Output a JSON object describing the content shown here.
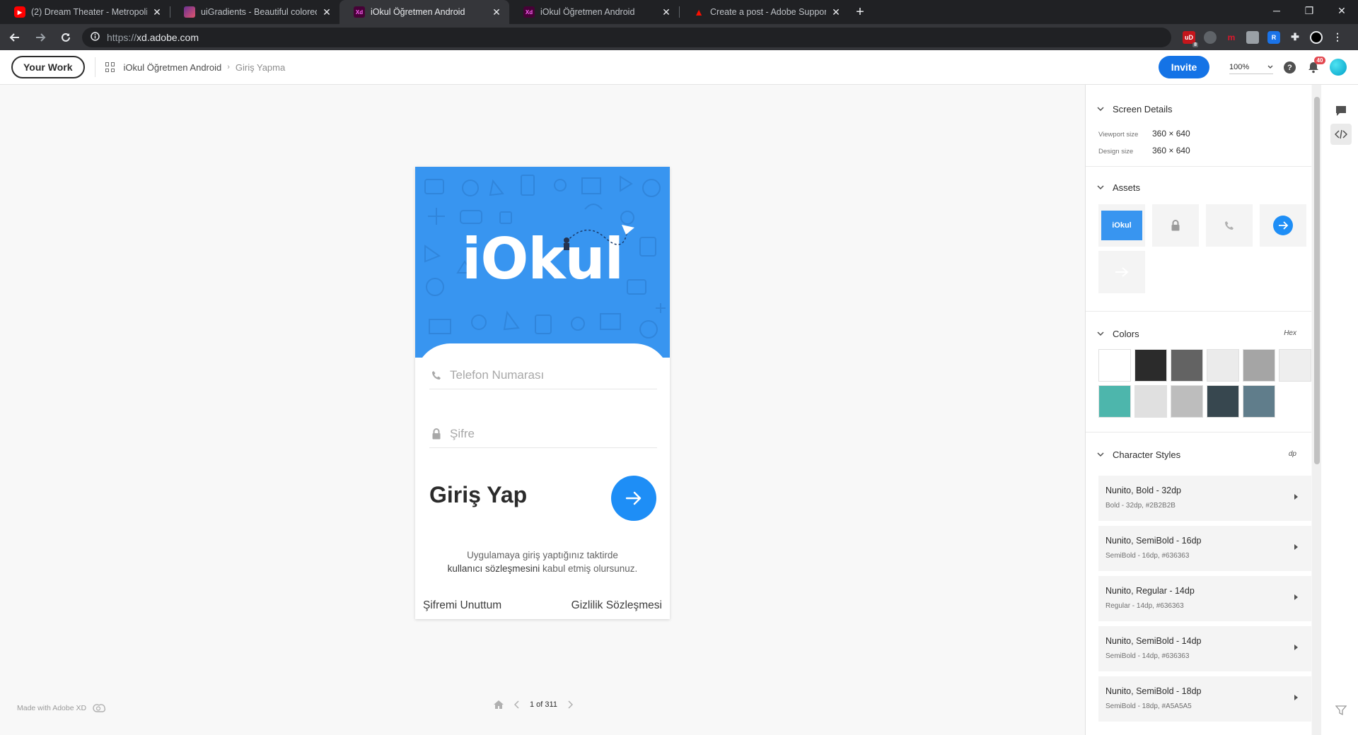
{
  "browser": {
    "tabs": [
      {
        "title": "(2) Dream Theater - Metropolis P",
        "favicon": "youtube-icon"
      },
      {
        "title": "uiGradients - Beautiful colored g",
        "favicon": "uigradients-icon"
      },
      {
        "title": "iOkul Öğretmen Android",
        "favicon": "xd-icon",
        "active": true
      },
      {
        "title": "iOkul Öğretmen Android",
        "favicon": "xd-icon"
      },
      {
        "title": "Create a post - Adobe Support C",
        "favicon": "adobe-icon"
      }
    ],
    "url_scheme": "https://",
    "url_host": "xd.adobe.com",
    "extension_badges": {
      "ud_count": "8"
    }
  },
  "header": {
    "your_work": "Your Work",
    "project": "iOkul Öğretmen Android",
    "screen": "Giriş Yapma",
    "invite": "Invite",
    "zoom": "100%",
    "notification_count": "40"
  },
  "artboard": {
    "logo": "iOkul",
    "phone_placeholder": "Telefon Numarası",
    "password_placeholder": "Şifre",
    "login_title": "Giriş Yap",
    "terms_line1": "Uygulamaya giriş yaptığınız taktirde",
    "terms_link": "kullanıcı sözleşmesini",
    "terms_line2_rest": " kabul etmiş olursunuz.",
    "forgot": "Şifremi Unuttum",
    "privacy": "Gizlilik Sözleşmesi",
    "colors": {
      "hero": "#3895F0",
      "button": "#1E8EF6"
    }
  },
  "footer": {
    "made_with": "Made with Adobe XD",
    "pager": "1 of 311"
  },
  "panel": {
    "screen_details": {
      "title": "Screen Details",
      "viewport_label": "Viewport size",
      "viewport_value": "360 × 640",
      "design_label": "Design size",
      "design_value": "360 × 640"
    },
    "assets": {
      "title": "Assets",
      "logo_label": "iOkul"
    },
    "colors": {
      "title": "Colors",
      "format": "Hex",
      "swatches": [
        "#FFFFFF",
        "#2B2B2B",
        "#636363",
        "#EBEBEB",
        "#A5A5A5",
        "#EEEEEE",
        "#4DB6AC",
        "#E0E0E0",
        "#BDBDBD",
        "#37474F",
        "#607D8B"
      ]
    },
    "character_styles": {
      "title": "Character Styles",
      "unit": "dp",
      "items": [
        {
          "name": "Nunito, Bold - 32dp",
          "desc": "Bold - 32dp, #2B2B2B"
        },
        {
          "name": "Nunito, SemiBold - 16dp",
          "desc": "SemiBold - 16dp, #636363"
        },
        {
          "name": "Nunito, Regular - 14dp",
          "desc": "Regular - 14dp, #636363"
        },
        {
          "name": "Nunito, SemiBold - 14dp",
          "desc": "SemiBold - 14dp, #636363"
        },
        {
          "name": "Nunito, SemiBold - 18dp",
          "desc": "SemiBold - 18dp, #A5A5A5"
        }
      ]
    }
  }
}
